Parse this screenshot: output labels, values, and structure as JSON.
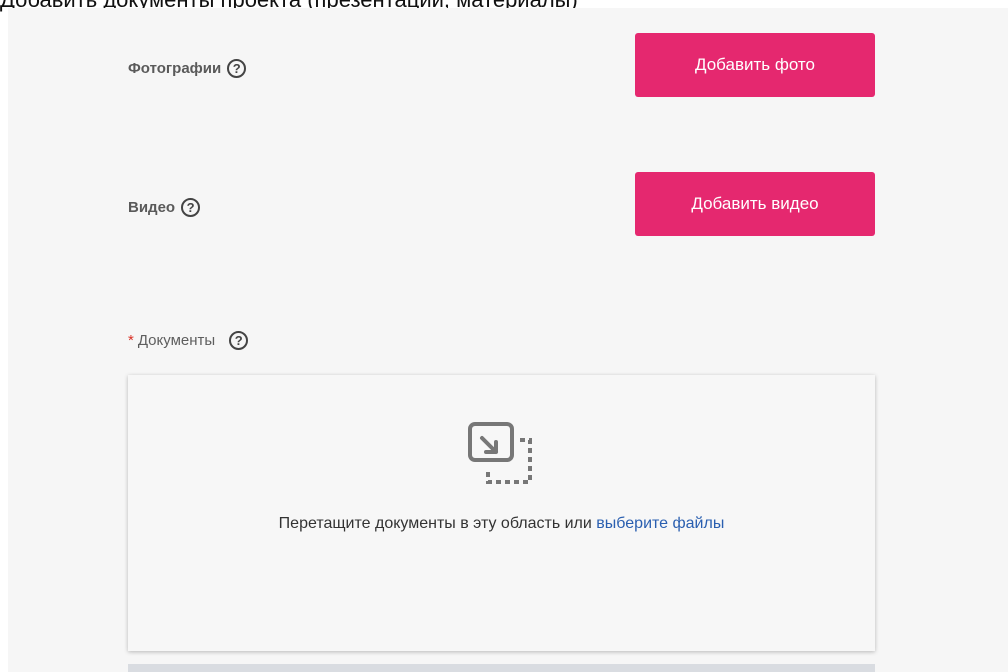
{
  "header": {
    "caption": "Добавить документы проекта (презентации, материалы)"
  },
  "photos": {
    "label": "Фотографии",
    "help": "?",
    "button_label": "Добавить фото"
  },
  "video": {
    "label": "Видео",
    "help": "?",
    "button_label": "Добавить видео"
  },
  "documents": {
    "required_marker": "*",
    "label": "Документы",
    "help": "?",
    "dropzone_text": "Перетащите документы в эту область или",
    "dropzone_link": "выберите файлы"
  },
  "colors": {
    "accent": "#e5286f",
    "link": "#2a5fb0",
    "panel": "#f6f6f6"
  }
}
